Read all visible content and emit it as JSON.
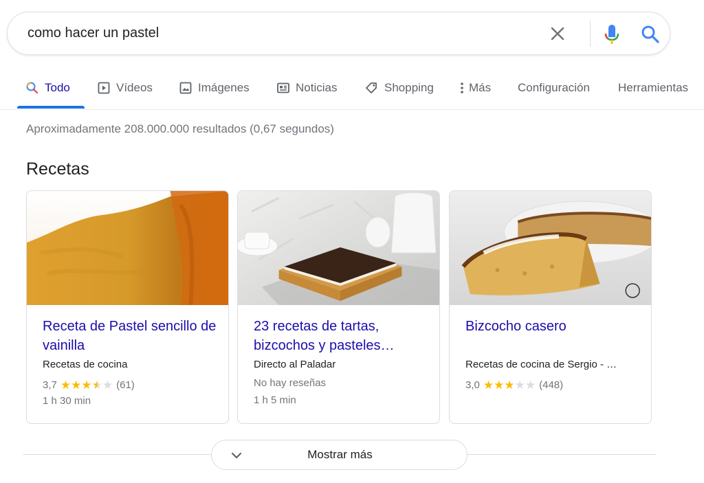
{
  "search": {
    "query": "como hacer un pastel"
  },
  "tabs": [
    {
      "label": "Todo",
      "icon": "search-icon"
    },
    {
      "label": "Vídeos",
      "icon": "play-icon"
    },
    {
      "label": "Imágenes",
      "icon": "image-icon"
    },
    {
      "label": "Noticias",
      "icon": "news-icon"
    },
    {
      "label": "Shopping",
      "icon": "tag-icon"
    },
    {
      "label": "Más",
      "icon": "more-vert-icon"
    },
    {
      "label": "Configuración"
    },
    {
      "label": "Herramientas"
    }
  ],
  "results": {
    "stats": "Aproximadamente 208.000.000 resultados (0,67 segundos)"
  },
  "recipes": {
    "title": "Recetas",
    "cards": [
      {
        "title": "Receta de Pastel sencillo de vainilla",
        "source": "Recetas de cocina",
        "rating": "3,7",
        "rating_value": 3.7,
        "reviews": "(61)",
        "time": "1 h 30 min"
      },
      {
        "title": "23 recetas de tartas, bizcochos y pasteles…",
        "source": "Directo al Paladar",
        "no_reviews": "No hay reseñas",
        "time": "1 h 5 min"
      },
      {
        "title": "Bizcocho casero",
        "source": "Recetas de cocina de Sergio - …",
        "rating": "3,0",
        "rating_value": 3.0,
        "reviews": "(448)"
      }
    ]
  },
  "show_more": {
    "label": "Mostrar más"
  },
  "colors": {
    "link": "#1a0dab",
    "accent": "#1a73e8",
    "star": "#fbbc04"
  }
}
